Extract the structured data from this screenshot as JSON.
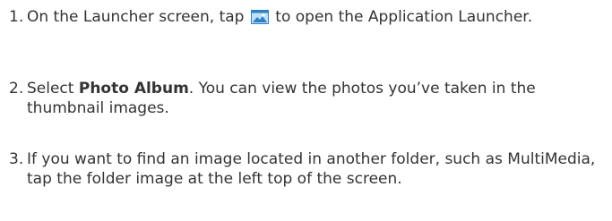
{
  "steps": [
    {
      "number": "1.",
      "before_icon": "On the Launcher screen, tap",
      "icon": "application-launcher-icon",
      "after_icon": "to open the Application Launcher."
    },
    {
      "number": "2.",
      "text_before": "Select ",
      "bold": "Photo Album",
      "text_after": ". You can view the photos you’ve taken in the thumbnail images."
    },
    {
      "number": "3.",
      "text": "If you want to find an image located in another folder, such as MultiMedia, tap the folder image at the left top of the screen."
    }
  ],
  "colors": {
    "text": "#333333",
    "icon_blue": "#2f7fc4",
    "icon_light": "#bfe1f7"
  }
}
